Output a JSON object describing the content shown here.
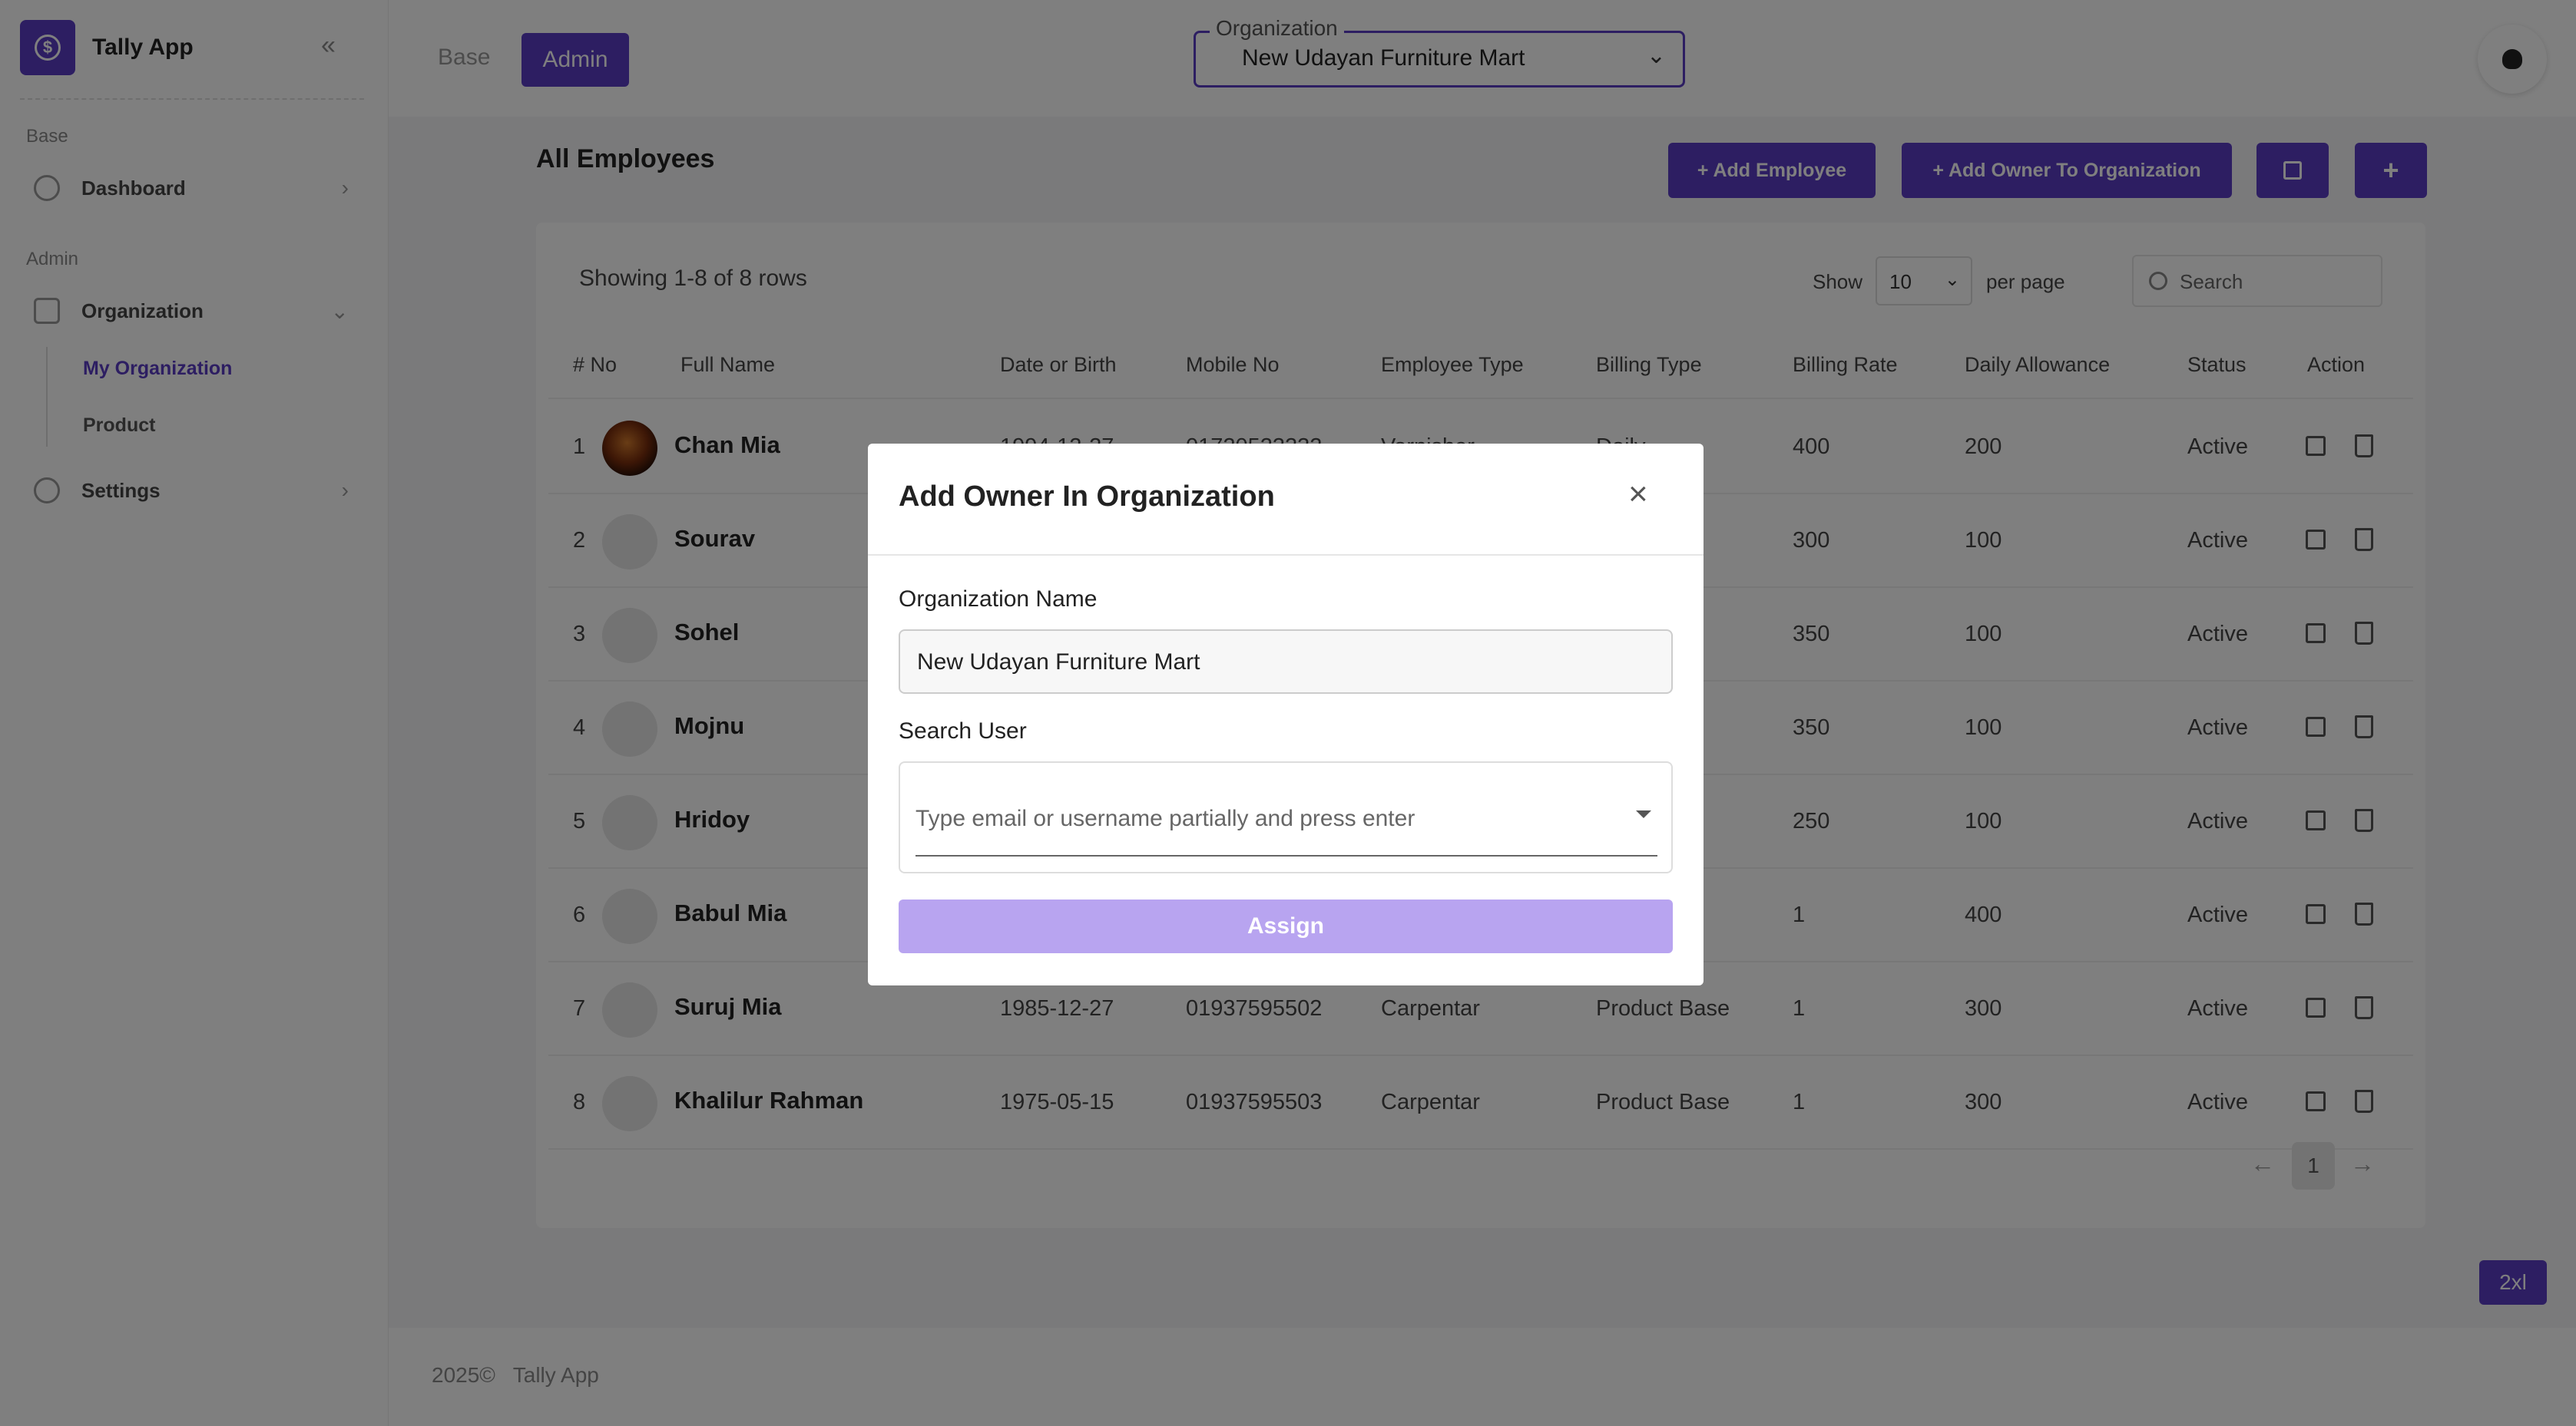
{
  "app": {
    "name": "Tally App",
    "collapse_icon": "double-chevron-left-icon"
  },
  "sidebar": {
    "sections": [
      {
        "label": "Base"
      },
      {
        "label": "Admin"
      }
    ],
    "items": [
      {
        "label": "Dashboard",
        "icon": "pie-chart-icon"
      },
      {
        "label": "Organization",
        "icon": "briefcase-icon"
      },
      {
        "label": "Settings",
        "icon": "gear-icon"
      }
    ],
    "subitems": [
      {
        "label": "My Organization"
      },
      {
        "label": "Product"
      }
    ]
  },
  "topbar": {
    "tabs": [
      {
        "label": "Base"
      },
      {
        "label": "Admin"
      }
    ],
    "org_select": {
      "legend": "Organization",
      "value": "New Udayan Furniture Mart"
    }
  },
  "main": {
    "title": "All Employees",
    "buttons": {
      "add_employee": "+ Add Employee",
      "add_owner": "+ Add Owner To Organization",
      "plus": "+"
    },
    "table": {
      "showing": "Showing 1-8 of 8 rows",
      "show_label": "Show",
      "per_page_value": "10",
      "per_page_label": "per page",
      "search_placeholder": "Search",
      "columns": [
        "# No",
        "Full Name",
        "Date or Birth",
        "Mobile No",
        "Employee Type",
        "Billing Type",
        "Billing Rate",
        "Daily Allowance",
        "Status",
        "Action"
      ],
      "rows": [
        {
          "no": "1",
          "name": "Chan Mia",
          "dob": "1994-12-27",
          "mobile": "01720523232",
          "type": "Varnisher",
          "billing": "Daily",
          "rate": "400",
          "allowance": "200",
          "status": "Active"
        },
        {
          "no": "2",
          "name": "Sourav",
          "dob": "",
          "mobile": "",
          "type": "",
          "billing": "",
          "rate": "300",
          "allowance": "100",
          "status": "Active"
        },
        {
          "no": "3",
          "name": "Sohel",
          "dob": "",
          "mobile": "",
          "type": "",
          "billing": "",
          "rate": "350",
          "allowance": "100",
          "status": "Active"
        },
        {
          "no": "4",
          "name": "Mojnu",
          "dob": "",
          "mobile": "",
          "type": "",
          "billing": "",
          "rate": "350",
          "allowance": "100",
          "status": "Active"
        },
        {
          "no": "5",
          "name": "Hridoy",
          "dob": "",
          "mobile": "",
          "type": "",
          "billing": "",
          "rate": "250",
          "allowance": "100",
          "status": "Active"
        },
        {
          "no": "6",
          "name": "Babul Mia",
          "dob": "",
          "mobile": "",
          "type": "",
          "billing": "ase",
          "rate": "1",
          "allowance": "400",
          "status": "Active"
        },
        {
          "no": "7",
          "name": "Suruj Mia",
          "dob": "1985-12-27",
          "mobile": "01937595502",
          "type": "Carpentar",
          "billing": "Product Base",
          "rate": "1",
          "allowance": "300",
          "status": "Active"
        },
        {
          "no": "8",
          "name": "Khalilur Rahman",
          "dob": "1975-05-15",
          "mobile": "01937595503",
          "type": "Carpentar",
          "billing": "Product Base",
          "rate": "1",
          "allowance": "300",
          "status": "Active"
        }
      ],
      "pagination": {
        "prev": "←",
        "page": "1",
        "next": "→"
      }
    }
  },
  "footer": {
    "year": "2025©",
    "app": "Tally App"
  },
  "breakpoint_badge": "2xl",
  "modal": {
    "title": "Add Owner In Organization",
    "close": "×",
    "org_label": "Organization Name",
    "org_value": "New Udayan Furniture Mart",
    "user_label": "Search User",
    "user_placeholder": "Type email or username partially and press enter",
    "assign": "Assign"
  },
  "colors": {
    "accent": "#5b3cc4",
    "assign_disabled": "#b8a4f0"
  }
}
